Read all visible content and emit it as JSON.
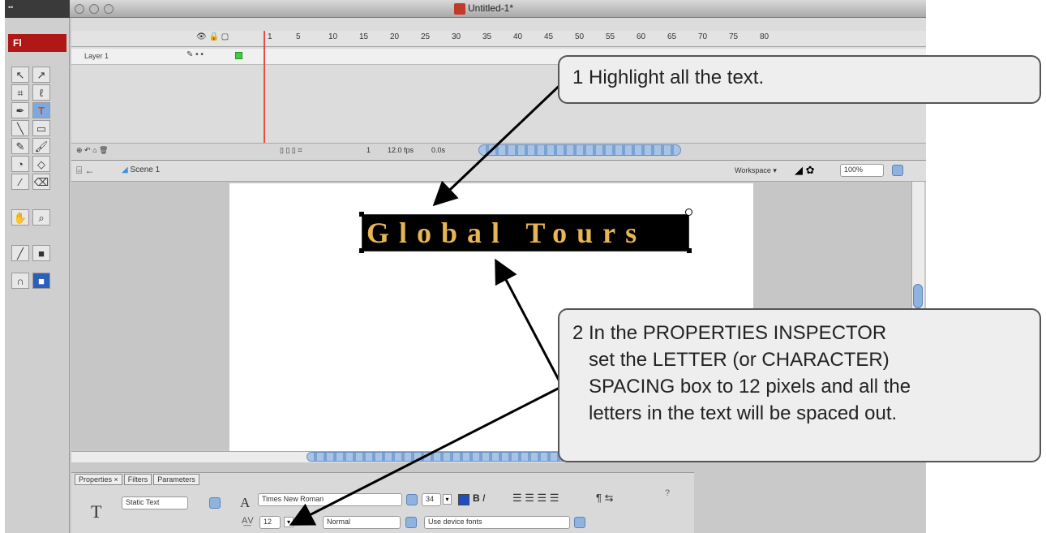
{
  "window": {
    "title": "Untitled-1*"
  },
  "tools": {
    "app_badge": "Fl"
  },
  "timeline": {
    "frame_numbers": [
      "1",
      "5",
      "10",
      "15",
      "20",
      "25",
      "30",
      "35",
      "40",
      "45",
      "50",
      "55",
      "60",
      "65",
      "70",
      "75",
      "80"
    ],
    "layer_name": "Layer 1",
    "current_frame": "1",
    "fps": "12.0 fps",
    "time": "0.0s"
  },
  "edit_bar": {
    "scene": "Scene 1",
    "workspace": "Workspace ▾",
    "zoom": "100%"
  },
  "stage": {
    "text": "Global Tours"
  },
  "properties": {
    "tabs": [
      "Properties ×",
      "Filters",
      "Parameters"
    ],
    "text_type": "Static Text",
    "font": "Times New Roman",
    "font_size": "34",
    "letter_spacing": "12",
    "kerning_label": "AI",
    "anti_alias": "Normal",
    "render": "Use device fonts",
    "text_tool_icon": "T"
  },
  "callouts": {
    "step1": "1 Highlight all the text.",
    "step2_lines": [
      "2 In the PROPERTIES INSPECTOR",
      "   set the LETTER (or CHARACTER)",
      "   SPACING box to 12 pixels and all the",
      "   letters in the text will be spaced out."
    ]
  },
  "colors": {
    "text_gold": "#e8b552",
    "playhead_red": "#e74c3c",
    "callout_bg": "#eeeeee"
  }
}
